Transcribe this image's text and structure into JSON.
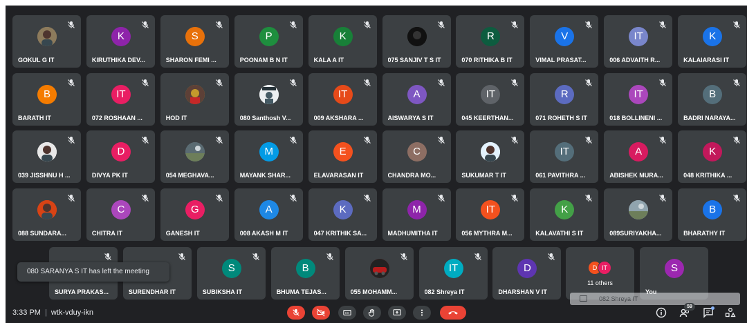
{
  "meeting": {
    "time": "3:33 PM",
    "code": "wtk-vduy-ikn",
    "participant_count": "59"
  },
  "toast": {
    "text": "080 SARANYA S IT has left the meeting"
  },
  "chat_peek": {
    "text": "082 Shreya IT"
  },
  "tiles": [
    {
      "name": "GOKUL G IT",
      "initial": "",
      "photo": "person-photo",
      "color": "#8d7b5c"
    },
    {
      "name": "KIRUTHIKA DEV...",
      "initial": "K",
      "color": "#8e24aa"
    },
    {
      "name": "SHARON FEMI ...",
      "initial": "S",
      "color": "#e8710a"
    },
    {
      "name": "POONAM B N IT",
      "initial": "P",
      "color": "#1e8e3e"
    },
    {
      "name": "KALA A IT",
      "initial": "K",
      "color": "#188038"
    },
    {
      "name": "075 SANJIV T S IT",
      "initial": "",
      "photo": "dark-photo",
      "color": "#1a1a1a"
    },
    {
      "name": "070 RITHIKA B IT",
      "initial": "R",
      "color": "#0d5c3f"
    },
    {
      "name": "VIMAL PRASAT...",
      "initial": "V",
      "color": "#1a73e8"
    },
    {
      "name": "006 ADVAITH R...",
      "initial": "IT",
      "color": "#7986cb"
    },
    {
      "name": "KALAIARASI IT",
      "initial": "K",
      "color": "#1a73e8"
    },
    {
      "name": "BARATH IT",
      "initial": "B",
      "color": "#f57c00"
    },
    {
      "name": "072 ROSHAAN ...",
      "initial": "IT",
      "color": "#e91e63"
    },
    {
      "name": "HOD IT",
      "initial": "",
      "photo": "portrait-photo",
      "color": "#c49a2c"
    },
    {
      "name": "080 Santhosh V...",
      "initial": "",
      "photo": "sandy-photo",
      "color": "#e0e0e0"
    },
    {
      "name": "009 AKSHARA ...",
      "initial": "IT",
      "color": "#e64a19"
    },
    {
      "name": "AISWARYA S IT",
      "initial": "A",
      "color": "#7e57c2"
    },
    {
      "name": "045 KEERTHAN...",
      "initial": "IT",
      "color": "#5f6368"
    },
    {
      "name": "071 ROHETH S IT",
      "initial": "R",
      "color": "#5c6bc0"
    },
    {
      "name": "018 BOLLINENI ...",
      "initial": "IT",
      "color": "#ab47bc"
    },
    {
      "name": "BADRI NARAYA...",
      "initial": "B",
      "color": "#546e7a"
    },
    {
      "name": "039 JISSHNU H ...",
      "initial": "",
      "photo": "person-photo",
      "color": "#e8e8e8"
    },
    {
      "name": "DIVYA PK IT",
      "initial": "D",
      "color": "#e91e63"
    },
    {
      "name": "054 MEGHAVA...",
      "initial": "",
      "photo": "landscape-photo",
      "color": "#5a6b72"
    },
    {
      "name": "MAYANK SHAR...",
      "initial": "M",
      "color": "#039be5"
    },
    {
      "name": "ELAVARASAN IT",
      "initial": "E",
      "color": "#f4511e"
    },
    {
      "name": "CHANDRA MO...",
      "initial": "C",
      "color": "#8d6e63"
    },
    {
      "name": "SUKUMAR T IT",
      "initial": "",
      "photo": "person-photo",
      "color": "#e3f2fd"
    },
    {
      "name": "061 PAVITHRA ...",
      "initial": "IT",
      "color": "#546e7a"
    },
    {
      "name": "ABISHEK MURA...",
      "initial": "A",
      "color": "#d81b60"
    },
    {
      "name": "048 KRITHIKA ...",
      "initial": "K",
      "color": "#c2185b"
    },
    {
      "name": "088 SUNDARA...",
      "initial": "",
      "photo": "person-photo",
      "color": "#d84315"
    },
    {
      "name": "CHITRA IT",
      "initial": "C",
      "color": "#ab47bc"
    },
    {
      "name": "GANESH IT",
      "initial": "G",
      "color": "#e91e63"
    },
    {
      "name": "008 AKASH M IT",
      "initial": "A",
      "color": "#1e88e5"
    },
    {
      "name": "047 KRITHIK SA...",
      "initial": "K",
      "color": "#5c6bc0"
    },
    {
      "name": "MADHUMITHA IT",
      "initial": "M",
      "color": "#8e24aa"
    },
    {
      "name": "056 MYTHRA M...",
      "initial": "IT",
      "color": "#f4511e"
    },
    {
      "name": "KALAVATHI S IT",
      "initial": "K",
      "color": "#43a047"
    },
    {
      "name": "089SURIYAKHA...",
      "initial": "",
      "photo": "landscape-photo",
      "color": "#90a4ae"
    },
    {
      "name": "BHARATHY IT",
      "initial": "B",
      "color": "#1a73e8"
    },
    {
      "name": "SURYA PRAKAS...",
      "initial": "",
      "color": "#3c4043"
    },
    {
      "name": "SURENDHAR IT",
      "initial": "",
      "color": "#3c4043"
    },
    {
      "name": "SUBIKSHA IT",
      "initial": "S",
      "color": "#00897b"
    },
    {
      "name": "BHUMA TEJAS...",
      "initial": "B",
      "color": "#00897b"
    },
    {
      "name": "055 MOHAMM...",
      "initial": "",
      "photo": "car-photo",
      "color": "#b71c1c"
    },
    {
      "name": "082 Shreya IT",
      "initial": "IT",
      "color": "#00acc1"
    },
    {
      "name": "DHARSHAN V IT",
      "initial": "D",
      "color": "#5e35b1"
    }
  ],
  "others_tile": {
    "label": "11 others",
    "mini": [
      {
        "initial": "D",
        "color": "#f4511e"
      },
      {
        "initial": "IT",
        "color": "#e91e63"
      }
    ]
  },
  "self_tile": {
    "name": "You",
    "initial": "S",
    "color": "#9c27b0"
  },
  "controls": [
    {
      "name": "mic-off-button",
      "icon": "mic-off-icon",
      "color": "#ea4335"
    },
    {
      "name": "camera-off-button",
      "icon": "camera-off-icon",
      "color": "#ea4335"
    },
    {
      "name": "captions-button",
      "icon": "captions-icon",
      "color": "#3c4043"
    },
    {
      "name": "raise-hand-button",
      "icon": "hand-icon",
      "color": "#3c4043"
    },
    {
      "name": "present-button",
      "icon": "present-icon",
      "color": "#3c4043"
    },
    {
      "name": "more-options-button",
      "icon": "more-vert-icon",
      "color": "#3c4043"
    },
    {
      "name": "leave-call-button",
      "icon": "call-end-icon",
      "color": "#ea4335"
    }
  ],
  "right_icons": [
    {
      "name": "info-button",
      "icon": "info-icon"
    },
    {
      "name": "people-button",
      "icon": "people-icon"
    },
    {
      "name": "chat-button",
      "icon": "chat-icon"
    },
    {
      "name": "activities-button",
      "icon": "activities-icon"
    }
  ]
}
